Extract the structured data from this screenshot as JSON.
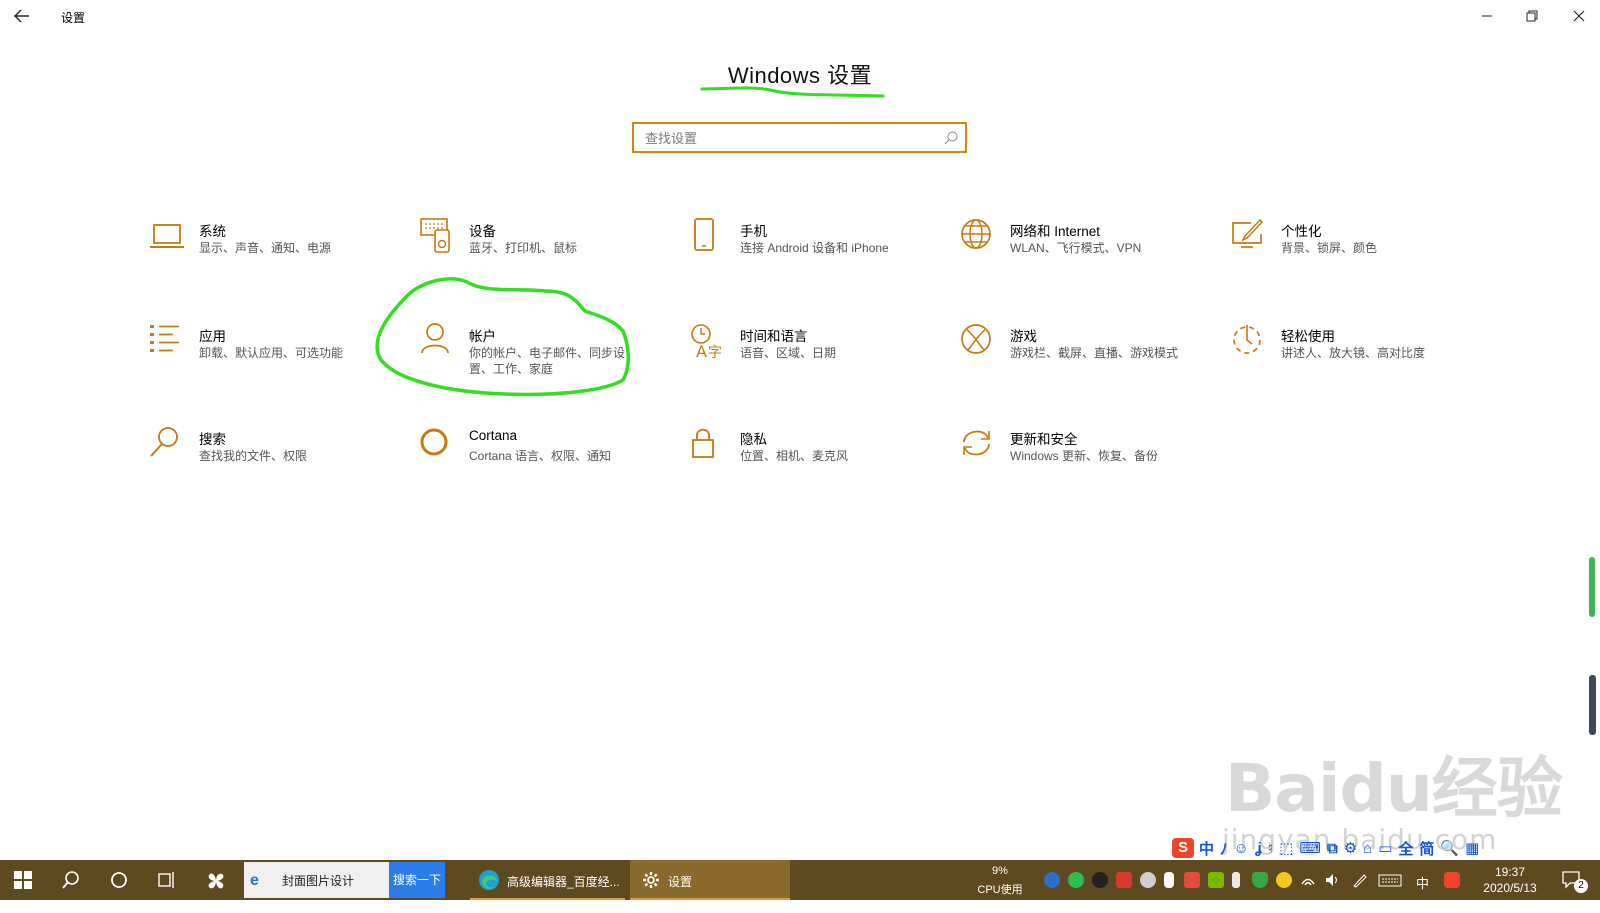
{
  "window": {
    "title": "设置",
    "back_glyph": "←",
    "controls": [
      "minimize-icon",
      "restore-icon",
      "close-icon"
    ]
  },
  "heading": "Windows 设置",
  "search": {
    "placeholder": "查找设置"
  },
  "colors": {
    "accent": "#d5860d",
    "annotation": "#33dd1f",
    "taskbar": "#5e4920"
  },
  "tiles": [
    {
      "title": "系统",
      "desc": "显示、声音、通知、电源",
      "icon": "laptop-icon"
    },
    {
      "title": "设备",
      "desc": "蓝牙、打印机、鼠标",
      "icon": "devices-icon"
    },
    {
      "title": "手机",
      "desc": "连接 Android 设备和 iPhone",
      "icon": "phone-icon"
    },
    {
      "title": "网络和 Internet",
      "desc": "WLAN、飞行模式、VPN",
      "icon": "globe-icon"
    },
    {
      "title": "个性化",
      "desc": "背景、锁屏、颜色",
      "icon": "paint-icon"
    },
    {
      "title": "应用",
      "desc": "卸载、默认应用、可选功能",
      "icon": "apps-list-icon"
    },
    {
      "title": "帐户",
      "desc": "你的帐户、电子邮件、同步设置、工作、家庭",
      "icon": "person-icon"
    },
    {
      "title": "时间和语言",
      "desc": "语音、区域、日期",
      "icon": "time-language-icon"
    },
    {
      "title": "游戏",
      "desc": "游戏栏、截屏、直播、游戏模式",
      "icon": "xbox-icon"
    },
    {
      "title": "轻松使用",
      "desc": "讲述人、放大镜、高对比度",
      "icon": "ease-of-access-icon"
    },
    {
      "title": "搜索",
      "desc": "查找我的文件、权限",
      "icon": "search-icon"
    },
    {
      "title": "Cortana",
      "desc": "Cortana 语言、权限、通知",
      "icon": "cortana-circle-icon"
    },
    {
      "title": "隐私",
      "desc": "位置、相机、麦克风",
      "icon": "lock-icon"
    },
    {
      "title": "更新和安全",
      "desc": "Windows 更新、恢复、备份",
      "icon": "sync-arrows-icon"
    }
  ],
  "watermark": {
    "main": "Baidu经验",
    "sub": "jingyan.baidu.com"
  },
  "ime": {
    "items": [
      "中",
      "ﾉ",
      "☺",
      "ʝ",
      "♮",
      "⬚",
      "⌨",
      "⧉",
      "⚙",
      "⌂",
      "▭",
      "全",
      "简",
      "🔍",
      "▦"
    ]
  },
  "taskbar": {
    "search_text": "封面图片设计",
    "search_ie_glyph": "e",
    "search_button": "搜索一下",
    "apps": [
      {
        "label": "高级编辑器_百度经...",
        "icon": "edge-icon"
      },
      {
        "label": "设置",
        "icon": "gear-icon"
      }
    ],
    "cpu_percent": "9%",
    "cpu_label": "CPU使用",
    "lang_indicator": "中",
    "time": "19:37",
    "date": "2020/5/13",
    "notification_count": "2"
  }
}
